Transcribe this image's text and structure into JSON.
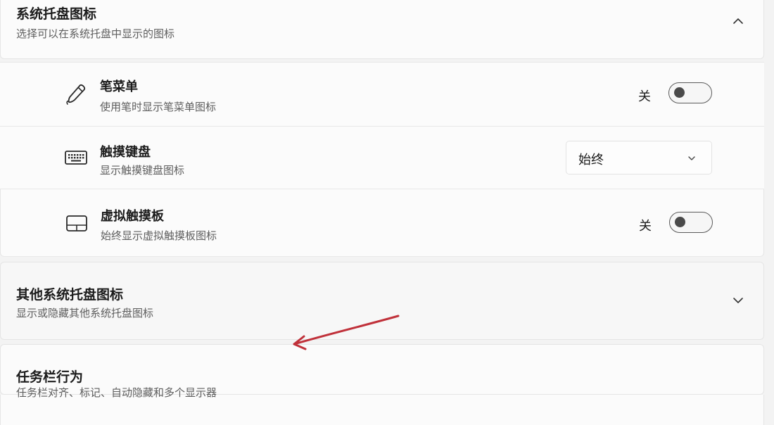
{
  "tray_section": {
    "title": "系统托盘图标",
    "subtitle": "选择可以在系统托盘中显示的图标",
    "chevron_icon": "chevron-up-icon",
    "items": [
      {
        "icon": "pen-icon",
        "title": "笔菜单",
        "subtitle": "使用笔时显示笔菜单图标",
        "control": "toggle",
        "state_label": "关",
        "on": false
      },
      {
        "icon": "keyboard-icon",
        "title": "触摸键盘",
        "subtitle": "显示触摸键盘图标",
        "control": "dropdown",
        "value": "始终",
        "chevron_icon": "chevron-down-icon"
      },
      {
        "icon": "touchpad-icon",
        "title": "虚拟触摸板",
        "subtitle": "始终显示虚拟触摸板图标",
        "control": "toggle",
        "state_label": "关",
        "on": false
      }
    ]
  },
  "other_tray_section": {
    "title": "其他系统托盘图标",
    "subtitle": "显示或隐藏其他系统托盘图标",
    "chevron_icon": "chevron-down-icon"
  },
  "taskbar_behavior_section": {
    "title": "任务栏行为",
    "subtitle": "任务栏对齐、标记、自动隐藏和多个显示器"
  },
  "annotation": {
    "color": "#c0313a",
    "icon": "red-arrow-annotation"
  }
}
